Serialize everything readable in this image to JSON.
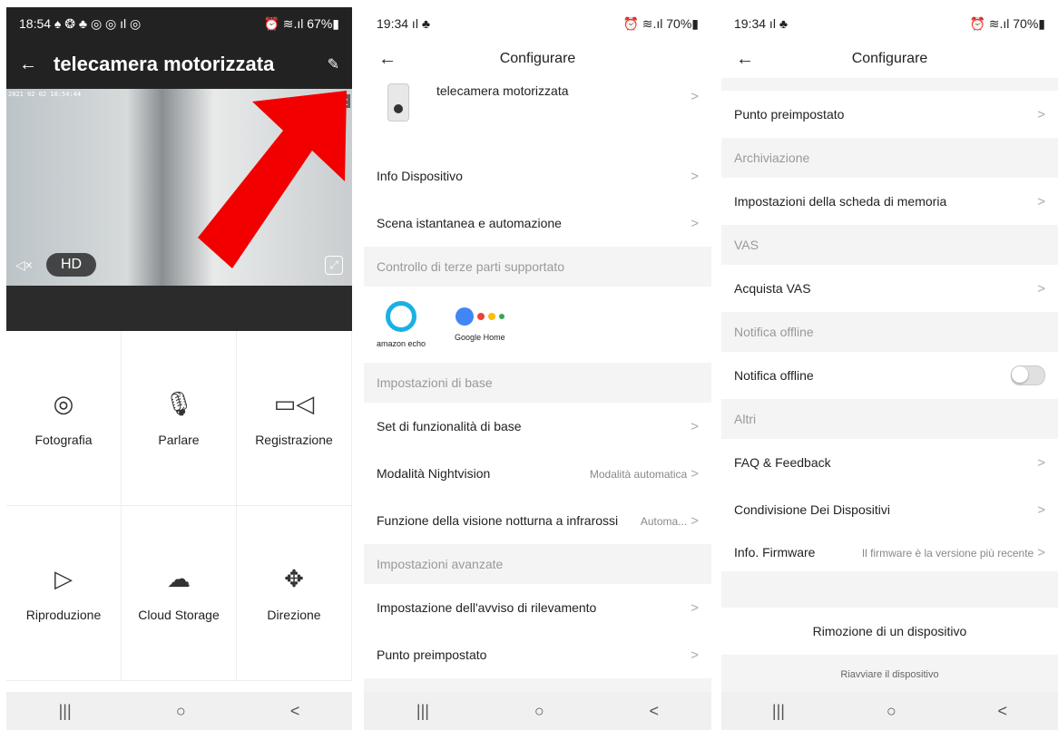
{
  "panel1": {
    "status_time": "18:54 ♠ ❂ ♣ ◎ ◎ ıl ◎",
    "status_right": "⏰ ≋.ıl 67%▮",
    "title": "telecamera motorizzata",
    "timestamp": "2021 02 02 18:54:44",
    "side_text": "ale:",
    "hd_label": "HD",
    "grid": [
      {
        "label": "Fotografia",
        "icon": "camera-icon",
        "glyph": "◎"
      },
      {
        "label": "Parlare",
        "icon": "mic-icon",
        "glyph": "🎙"
      },
      {
        "label": "Registrazione",
        "icon": "video-icon",
        "glyph": "▭◁"
      },
      {
        "label": "Riproduzione",
        "icon": "play-circle-icon",
        "glyph": "▷"
      },
      {
        "label": "Cloud Storage",
        "icon": "cloud-icon",
        "glyph": "☁"
      },
      {
        "label": "Direzione",
        "icon": "move-icon",
        "glyph": "✥"
      }
    ]
  },
  "panel2": {
    "status_time": "19:34 ıl ♣",
    "status_right": "⏰ ≋.ıl 70%▮",
    "title": "Configurare",
    "device_name": "telecamera motorizzata",
    "rows1": [
      {
        "label": "Info Dispositivo"
      },
      {
        "label": "Scena istantanea e automazione"
      }
    ],
    "sec_third": "Controllo di terze parti supportato",
    "alexa_label": "amazon echo",
    "google_label": "Google Home",
    "sec_base": "Impostazioni di base",
    "rows2": [
      {
        "label": "Set di funzionalità di base",
        "value": ""
      },
      {
        "label": "Modalità Nightvision",
        "value": "Modalità automatica"
      },
      {
        "label": "Funzione della visione notturna a infrarossi",
        "value": "Automa..."
      }
    ],
    "sec_adv": "Impostazioni avanzate",
    "rows3": [
      {
        "label": "Impostazione dell'avviso di rilevamento"
      },
      {
        "label": "Punto preimpostato"
      }
    ],
    "sec_arch": "Archiviazione"
  },
  "panel3": {
    "status_time": "19:34 ıl ♣",
    "status_right": "⏰ ≋.ıl 70%▮",
    "title": "Configurare",
    "preset": "Punto preimpostato",
    "sec_arch": "Archiviazione",
    "memcard": "Impostazioni della scheda di memoria",
    "sec_vas": "VAS",
    "buy_vas": "Acquista VAS",
    "sec_offline": "Notifica offline",
    "offline_row": "Notifica offline",
    "sec_altri": "Altri",
    "faq": "FAQ & Feedback",
    "share": "Condivisione Dei Dispositivi",
    "fw_label": "Info. Firmware",
    "fw_value": "Il firmware è la versione più recente",
    "remove": "Rimozione di un dispositivo",
    "restart": "Riavviare il dispositivo"
  },
  "nav": {
    "recent": "|||",
    "home": "○",
    "back": "<"
  },
  "glyphs": {
    "back": "←",
    "chevron": ">",
    "edit": "✎"
  }
}
